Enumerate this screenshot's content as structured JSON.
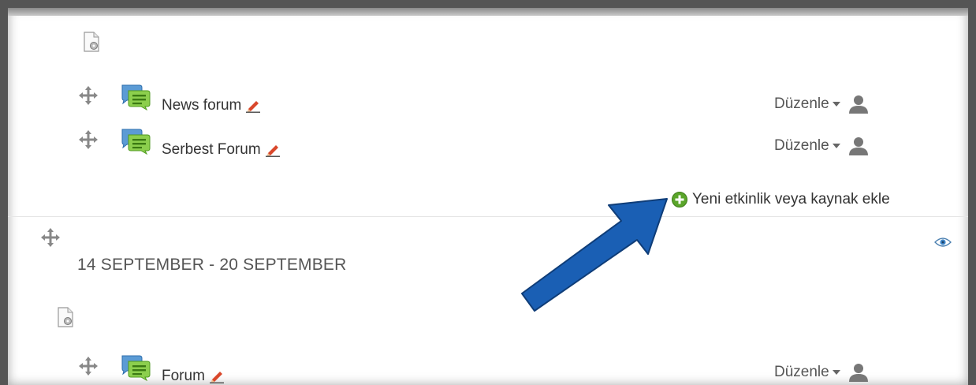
{
  "section1": {
    "activities": [
      {
        "name": "News forum",
        "edit_label": "Düzenle"
      },
      {
        "name": "Serbest Forum",
        "edit_label": "Düzenle"
      }
    ],
    "add_link_label": "Yeni etkinlik veya kaynak ekle"
  },
  "section2": {
    "title": "14 SEPTEMBER - 20 SEPTEMBER",
    "activities": [
      {
        "name": "Forum",
        "edit_label": "Düzenle"
      }
    ]
  },
  "colors": {
    "arrow": "#1a5fb4",
    "forum_green": "#7cc242",
    "forum_blue": "#4a90d9"
  }
}
